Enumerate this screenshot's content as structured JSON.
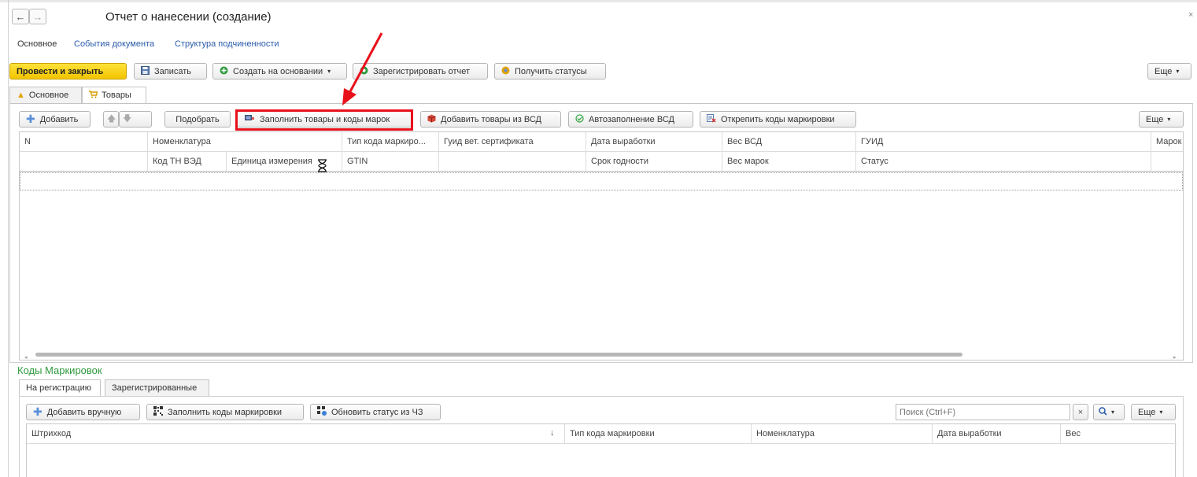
{
  "window": {
    "title": "Отчет о нанесении (создание)",
    "close": "×",
    "back": "←",
    "forward": "→"
  },
  "nav_links": [
    "Основное",
    "События документа",
    "Структура подчиненности"
  ],
  "toolbar": {
    "post_close": "Провести и закрыть",
    "save": "Записать",
    "create_based": "Создать на основании",
    "register_report": "Зарегистрировать отчет",
    "get_statuses": "Получить статусы",
    "more": "Еще"
  },
  "tabs": [
    {
      "label": "Основное"
    },
    {
      "label": "Товары"
    }
  ],
  "goods_toolbar": {
    "add": "Добавить",
    "pick": "Подобрать",
    "fill_goods_codes": "Заполнить товары и коды марок",
    "add_from_vsd": "Добавить товары из ВСД",
    "autofill_vsd": "Автозаполнение ВСД",
    "unlink_codes": "Открепить коды маркировки",
    "more": "Еще"
  },
  "goods_table": {
    "header_row1": [
      "N",
      "Номенклатура",
      "Тип кода маркиро...",
      "Гуид вет. сертификата",
      "Дата выработки",
      "Вес ВСД",
      "ГУИД",
      "Марок"
    ],
    "header_row2": [
      "Код ТН ВЭД",
      "Единица измерения",
      "GTIN",
      "Срок годности",
      "Вес марок",
      "Статус"
    ]
  },
  "codes_section": {
    "title": "Коды Маркировок",
    "tabs": [
      "На регистрацию",
      "Зарегистрированные"
    ],
    "add_manual": "Добавить вручную",
    "fill_codes": "Заполнить коды маркировки",
    "update_status": "Обновить статус из ЧЗ",
    "search_placeholder": "Поиск (Ctrl+F)",
    "search_clear": "×",
    "more": "Еще",
    "columns": [
      "Штрихкод",
      "Тип кода маркировки",
      "Номенклатура",
      "Дата выработки",
      "Вес"
    ],
    "sort_indicator": "↓"
  },
  "colors": {
    "accent_yellow": "#f5c800",
    "annotation_red": "#e8111b",
    "section_green": "#2e9a3e",
    "link_blue": "#2a5caa"
  }
}
